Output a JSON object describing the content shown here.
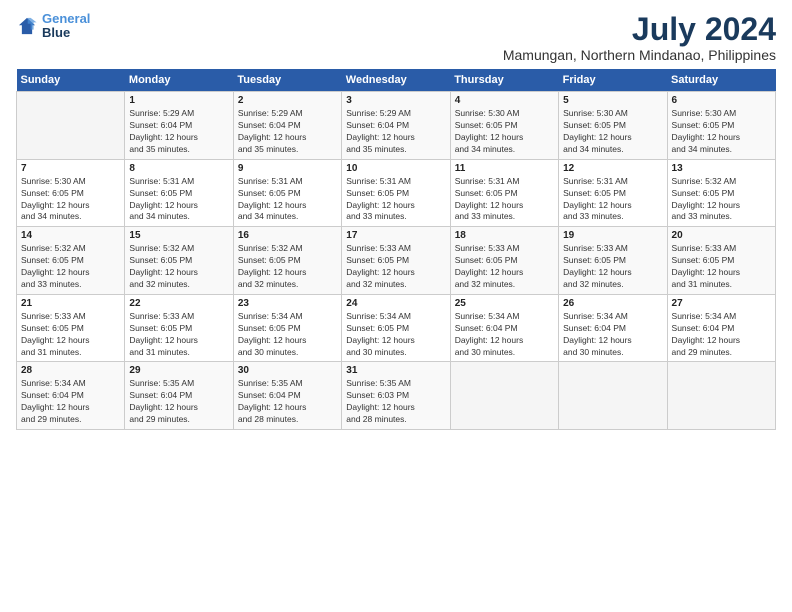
{
  "logo": {
    "line1": "General",
    "line2": "Blue"
  },
  "title": "July 2024",
  "subtitle": "Mamungan, Northern Mindanao, Philippines",
  "days_header": [
    "Sunday",
    "Monday",
    "Tuesday",
    "Wednesday",
    "Thursday",
    "Friday",
    "Saturday"
  ],
  "weeks": [
    [
      {
        "num": "",
        "info": ""
      },
      {
        "num": "1",
        "info": "Sunrise: 5:29 AM\nSunset: 6:04 PM\nDaylight: 12 hours\nand 35 minutes."
      },
      {
        "num": "2",
        "info": "Sunrise: 5:29 AM\nSunset: 6:04 PM\nDaylight: 12 hours\nand 35 minutes."
      },
      {
        "num": "3",
        "info": "Sunrise: 5:29 AM\nSunset: 6:04 PM\nDaylight: 12 hours\nand 35 minutes."
      },
      {
        "num": "4",
        "info": "Sunrise: 5:30 AM\nSunset: 6:05 PM\nDaylight: 12 hours\nand 34 minutes."
      },
      {
        "num": "5",
        "info": "Sunrise: 5:30 AM\nSunset: 6:05 PM\nDaylight: 12 hours\nand 34 minutes."
      },
      {
        "num": "6",
        "info": "Sunrise: 5:30 AM\nSunset: 6:05 PM\nDaylight: 12 hours\nand 34 minutes."
      }
    ],
    [
      {
        "num": "7",
        "info": "Sunrise: 5:30 AM\nSunset: 6:05 PM\nDaylight: 12 hours\nand 34 minutes."
      },
      {
        "num": "8",
        "info": "Sunrise: 5:31 AM\nSunset: 6:05 PM\nDaylight: 12 hours\nand 34 minutes."
      },
      {
        "num": "9",
        "info": "Sunrise: 5:31 AM\nSunset: 6:05 PM\nDaylight: 12 hours\nand 34 minutes."
      },
      {
        "num": "10",
        "info": "Sunrise: 5:31 AM\nSunset: 6:05 PM\nDaylight: 12 hours\nand 33 minutes."
      },
      {
        "num": "11",
        "info": "Sunrise: 5:31 AM\nSunset: 6:05 PM\nDaylight: 12 hours\nand 33 minutes."
      },
      {
        "num": "12",
        "info": "Sunrise: 5:31 AM\nSunset: 6:05 PM\nDaylight: 12 hours\nand 33 minutes."
      },
      {
        "num": "13",
        "info": "Sunrise: 5:32 AM\nSunset: 6:05 PM\nDaylight: 12 hours\nand 33 minutes."
      }
    ],
    [
      {
        "num": "14",
        "info": "Sunrise: 5:32 AM\nSunset: 6:05 PM\nDaylight: 12 hours\nand 33 minutes."
      },
      {
        "num": "15",
        "info": "Sunrise: 5:32 AM\nSunset: 6:05 PM\nDaylight: 12 hours\nand 32 minutes."
      },
      {
        "num": "16",
        "info": "Sunrise: 5:32 AM\nSunset: 6:05 PM\nDaylight: 12 hours\nand 32 minutes."
      },
      {
        "num": "17",
        "info": "Sunrise: 5:33 AM\nSunset: 6:05 PM\nDaylight: 12 hours\nand 32 minutes."
      },
      {
        "num": "18",
        "info": "Sunrise: 5:33 AM\nSunset: 6:05 PM\nDaylight: 12 hours\nand 32 minutes."
      },
      {
        "num": "19",
        "info": "Sunrise: 5:33 AM\nSunset: 6:05 PM\nDaylight: 12 hours\nand 32 minutes."
      },
      {
        "num": "20",
        "info": "Sunrise: 5:33 AM\nSunset: 6:05 PM\nDaylight: 12 hours\nand 31 minutes."
      }
    ],
    [
      {
        "num": "21",
        "info": "Sunrise: 5:33 AM\nSunset: 6:05 PM\nDaylight: 12 hours\nand 31 minutes."
      },
      {
        "num": "22",
        "info": "Sunrise: 5:33 AM\nSunset: 6:05 PM\nDaylight: 12 hours\nand 31 minutes."
      },
      {
        "num": "23",
        "info": "Sunrise: 5:34 AM\nSunset: 6:05 PM\nDaylight: 12 hours\nand 30 minutes."
      },
      {
        "num": "24",
        "info": "Sunrise: 5:34 AM\nSunset: 6:05 PM\nDaylight: 12 hours\nand 30 minutes."
      },
      {
        "num": "25",
        "info": "Sunrise: 5:34 AM\nSunset: 6:04 PM\nDaylight: 12 hours\nand 30 minutes."
      },
      {
        "num": "26",
        "info": "Sunrise: 5:34 AM\nSunset: 6:04 PM\nDaylight: 12 hours\nand 30 minutes."
      },
      {
        "num": "27",
        "info": "Sunrise: 5:34 AM\nSunset: 6:04 PM\nDaylight: 12 hours\nand 29 minutes."
      }
    ],
    [
      {
        "num": "28",
        "info": "Sunrise: 5:34 AM\nSunset: 6:04 PM\nDaylight: 12 hours\nand 29 minutes."
      },
      {
        "num": "29",
        "info": "Sunrise: 5:35 AM\nSunset: 6:04 PM\nDaylight: 12 hours\nand 29 minutes."
      },
      {
        "num": "30",
        "info": "Sunrise: 5:35 AM\nSunset: 6:04 PM\nDaylight: 12 hours\nand 28 minutes."
      },
      {
        "num": "31",
        "info": "Sunrise: 5:35 AM\nSunset: 6:03 PM\nDaylight: 12 hours\nand 28 minutes."
      },
      {
        "num": "",
        "info": ""
      },
      {
        "num": "",
        "info": ""
      },
      {
        "num": "",
        "info": ""
      }
    ]
  ]
}
